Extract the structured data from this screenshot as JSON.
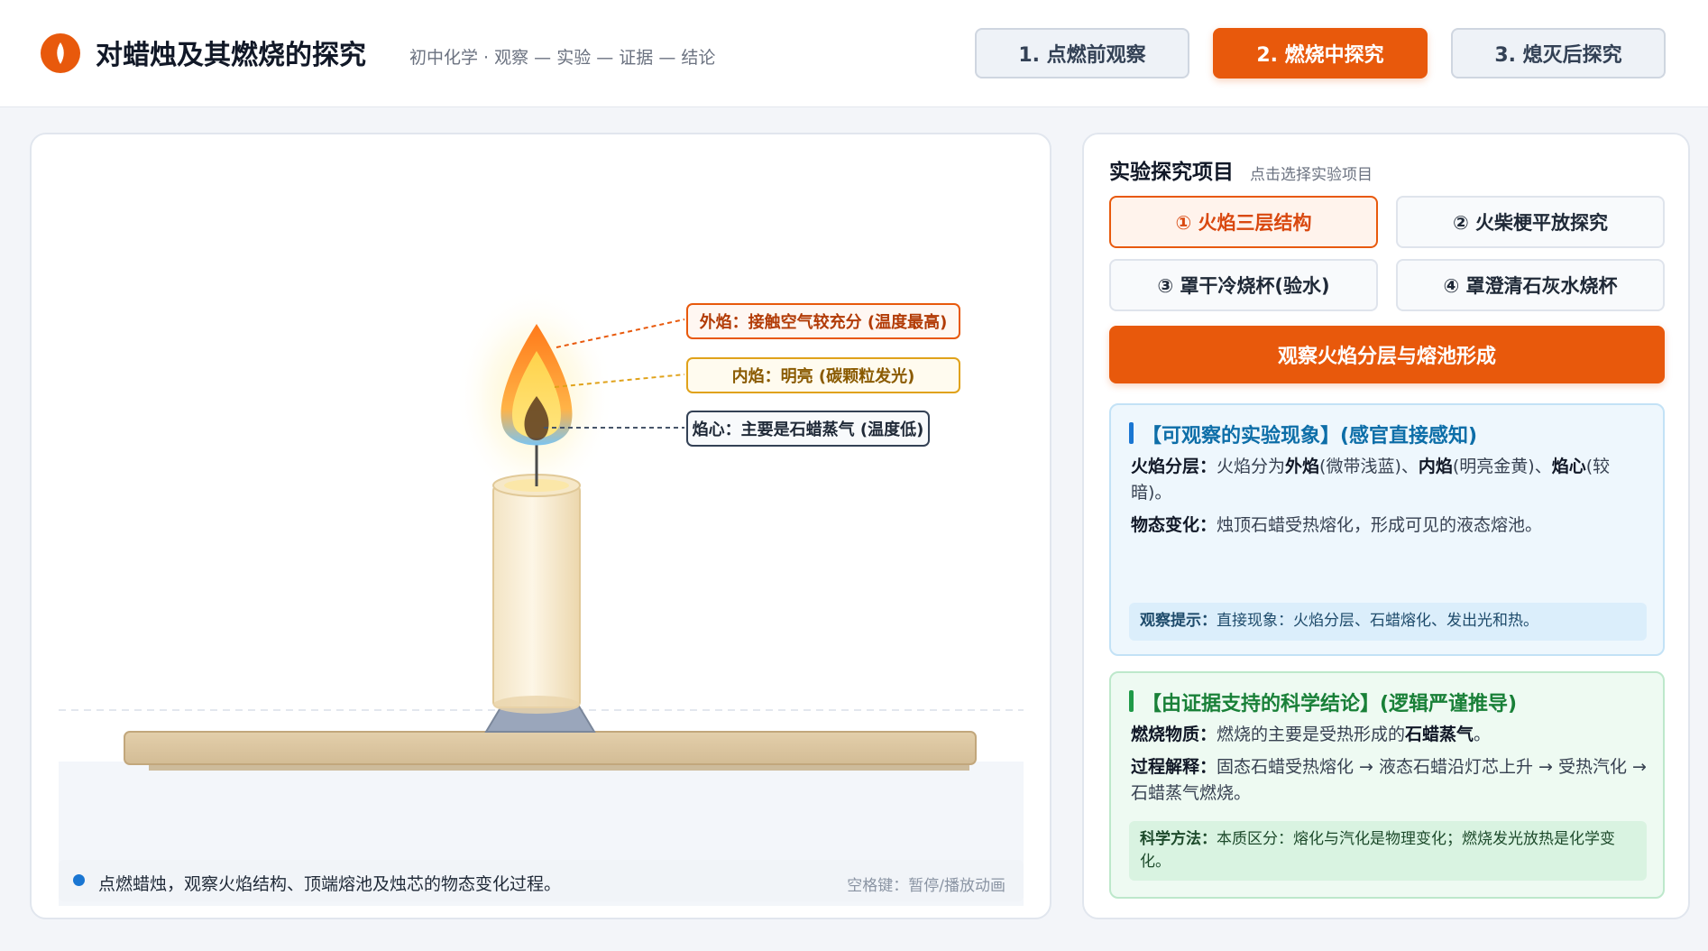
{
  "app": {
    "title": "对蜡烛及其燃烧的探究",
    "subtitle": "初中化学 · 观察 — 实验 — 证据 — 结论"
  },
  "stages": [
    {
      "label": "1. 点燃前观察",
      "active": false
    },
    {
      "label": "2. 燃烧中探究",
      "active": true
    },
    {
      "label": "3. 熄灭后探究",
      "active": false
    }
  ],
  "stage_view": {
    "labels": {
      "outer": "外焰：接触空气较充分 (温度最高)",
      "inner": "内焰：明亮 (碳颗粒发光)",
      "core": "焰心：主要是石蜡蒸气 (温度低)"
    },
    "status": "点燃蜡烛，观察火焰结构、顶端熔池及烛芯的物态变化过程。",
    "hint": "空格键：暂停/播放动画"
  },
  "side": {
    "title": "实验探究项目",
    "subtitle": "点击选择实验项目",
    "experiments": [
      {
        "label": "① 火焰三层结构",
        "active": true
      },
      {
        "label": "② 火柴梗平放探究",
        "active": false
      },
      {
        "label": "③ 罩干冷烧杯(验水)",
        "active": false
      },
      {
        "label": "④ 罩澄清石灰水烧杯",
        "active": false
      }
    ],
    "action": "观察火焰分层与熔池形成",
    "observation": {
      "heading": "【可观察的实验现象】(感官直接感知)",
      "line1_key": "火焰分层：",
      "line1_a": "火焰分为",
      "line1_b": "外焰",
      "line1_c": "(微带浅蓝)、",
      "line1_d": "内焰",
      "line1_e": "(明亮金黄)、",
      "line1_f": "焰心",
      "line1_g": "(较暗)。",
      "line2_key": "物态变化：",
      "line2_text": "烛顶石蜡受热熔化，形成可见的液态熔池。",
      "tip_key": "观察提示：",
      "tip_text": "直接现象：火焰分层、石蜡熔化、发出光和热。"
    },
    "conclusion": {
      "heading": "【由证据支持的科学结论】(逻辑严谨推导)",
      "line1_key": "燃烧物质：",
      "line1_a": "燃烧的主要是受热形成的",
      "line1_b": "石蜡蒸气",
      "line1_c": "。",
      "line2_key": "过程解释：",
      "line2_text": "固态石蜡受热熔化 → 液态石蜡沿灯芯上升 → 受热汽化 → 石蜡蒸气燃烧。",
      "tip_key": "科学方法：",
      "tip_text": "本质区分：熔化与汽化是物理变化；燃烧发光放热是化学变化。"
    }
  },
  "colors": {
    "accent": "#e8590c",
    "info": "#1a76d2",
    "success": "#1f9a48"
  }
}
